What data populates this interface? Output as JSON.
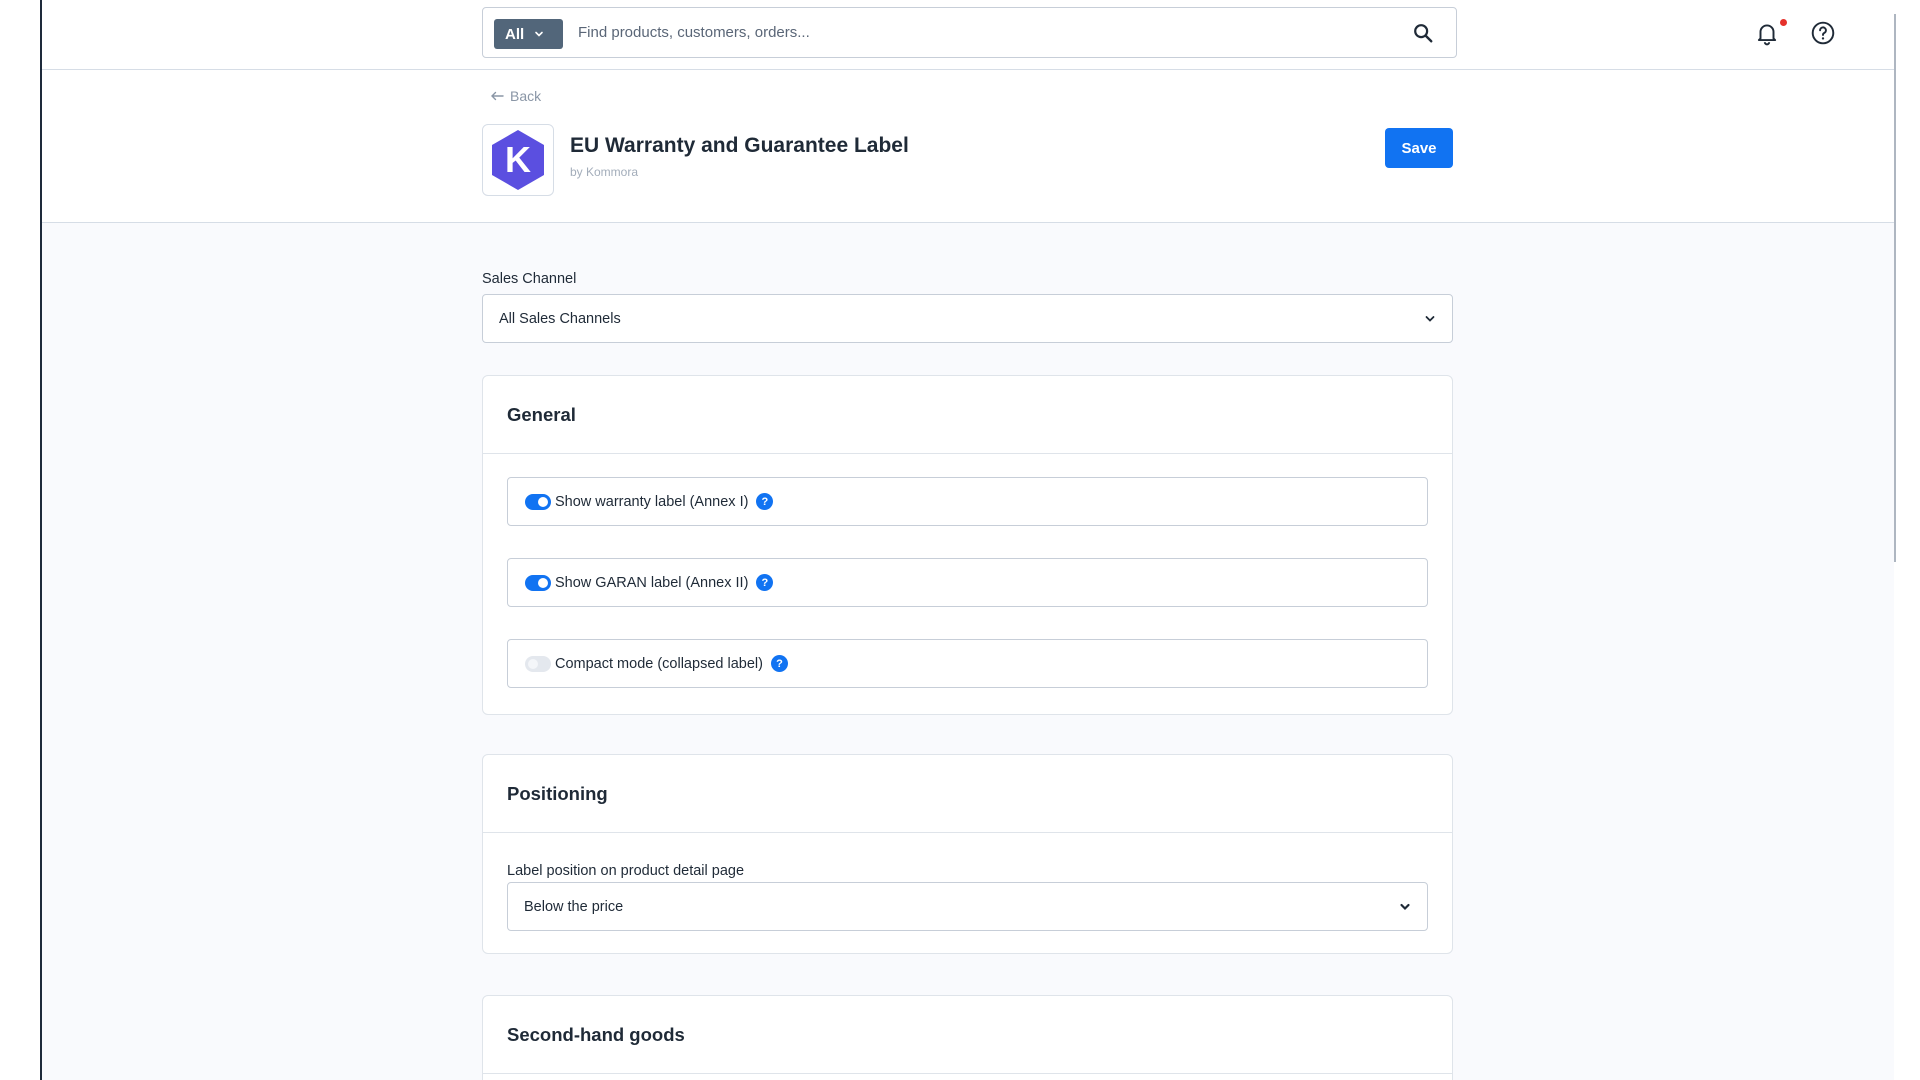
{
  "search": {
    "type_label": "All",
    "placeholder": "Find products, customers, orders..."
  },
  "header": {
    "back_label": "Back",
    "app_title": "EU Warranty and Guarantee Label",
    "app_vendor": "by Kommora",
    "logo_letter": "K",
    "save_label": "Save"
  },
  "sales_channel": {
    "label": "Sales Channel",
    "value": "All Sales Channels"
  },
  "general": {
    "title": "General",
    "toggles": [
      {
        "label": "Show warranty label (Annex I)",
        "enabled": true
      },
      {
        "label": "Show GARAN label (Annex II)",
        "enabled": true
      },
      {
        "label": "Compact mode (collapsed label)",
        "enabled": false
      }
    ]
  },
  "positioning": {
    "title": "Positioning",
    "field_label": "Label position on product detail page",
    "value": "Below the price"
  },
  "second_hand": {
    "title": "Second-hand goods"
  },
  "colors": {
    "primary": "#1173f2",
    "logo_purple": "#5b4fe0",
    "notification_dot": "#e5312b"
  }
}
